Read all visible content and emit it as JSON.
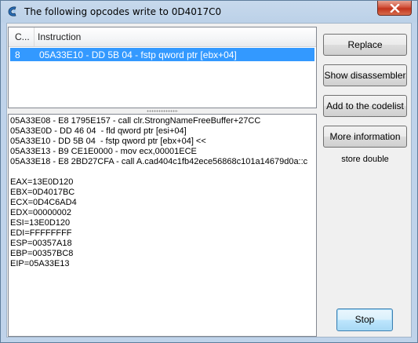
{
  "window": {
    "title": "The following opcodes write to 0D4017C0",
    "app_icon": "cheat-engine-icon",
    "close_icon": "close-icon"
  },
  "list": {
    "columns": [
      "C...",
      "Instruction"
    ],
    "rows": [
      {
        "count": "8",
        "instruction": "05A33E10 - DD 5B 04  - fstp qword ptr [ebx+04]",
        "selected": true
      }
    ],
    "selection_color": "#3399ff"
  },
  "details": {
    "lines": [
      "05A33E08 - E8 1795E157 - call clr.StrongNameFreeBuffer+27CC",
      "05A33E0D - DD 46 04  - fld qword ptr [esi+04]",
      "05A33E10 - DD 5B 04  - fstp qword ptr [ebx+04] <<",
      "05A33E13 - B9 CE1E0000 - mov ecx,00001ECE",
      "05A33E18 - E8 2BD27CFA - call A.cad404c1fb42ece56868c101a14679d0a::c",
      "",
      "EAX=13E0D120",
      "EBX=0D4017BC",
      "ECX=0D4C6AD4",
      "EDX=00000002",
      "ESI=13E0D120",
      "EDI=FFFFFFFF",
      "ESP=00357A18",
      "EBP=00357BC8",
      "EIP=05A33E13"
    ]
  },
  "buttons": {
    "replace": "Replace",
    "show_disassembler": "Show disassembler",
    "add_to_codelist": "Add to the codelist",
    "more_information": "More information",
    "stop": "Stop"
  },
  "info_label": "store double"
}
